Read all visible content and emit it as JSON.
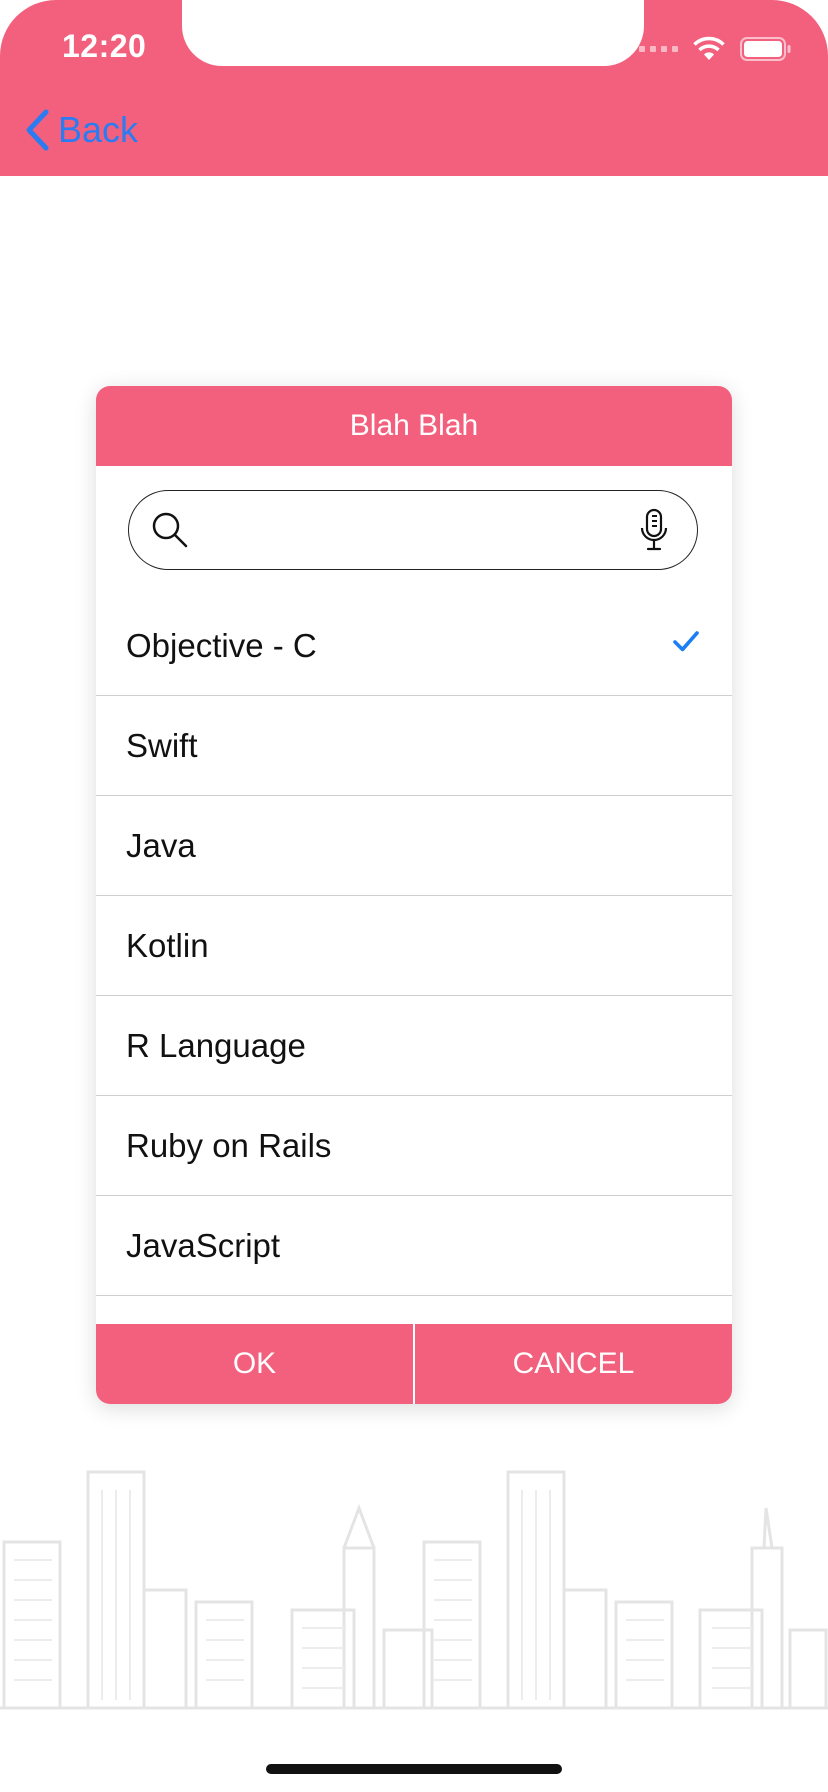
{
  "status_bar": {
    "time": "12:20"
  },
  "nav": {
    "back_label": "Back"
  },
  "dialog": {
    "title": "Blah Blah",
    "search": {
      "placeholder": "",
      "value": ""
    },
    "items": [
      {
        "label": "Objective - C",
        "selected": true
      },
      {
        "label": "Swift",
        "selected": false
      },
      {
        "label": "Java",
        "selected": false
      },
      {
        "label": "Kotlin",
        "selected": false
      },
      {
        "label": "R Language",
        "selected": false
      },
      {
        "label": "Ruby on Rails",
        "selected": false
      },
      {
        "label": "JavaScript",
        "selected": false
      },
      {
        "label": "",
        "selected": false
      }
    ],
    "ok_label": "OK",
    "cancel_label": "CANCEL"
  },
  "colors": {
    "accent": "#f3607d",
    "link": "#2b7cf2",
    "check": "#1a7ff5"
  },
  "icons": [
    "back-chevron-icon",
    "search-icon",
    "microphone-icon",
    "checkmark-icon",
    "wifi-icon",
    "battery-icon",
    "signal-icon"
  ]
}
